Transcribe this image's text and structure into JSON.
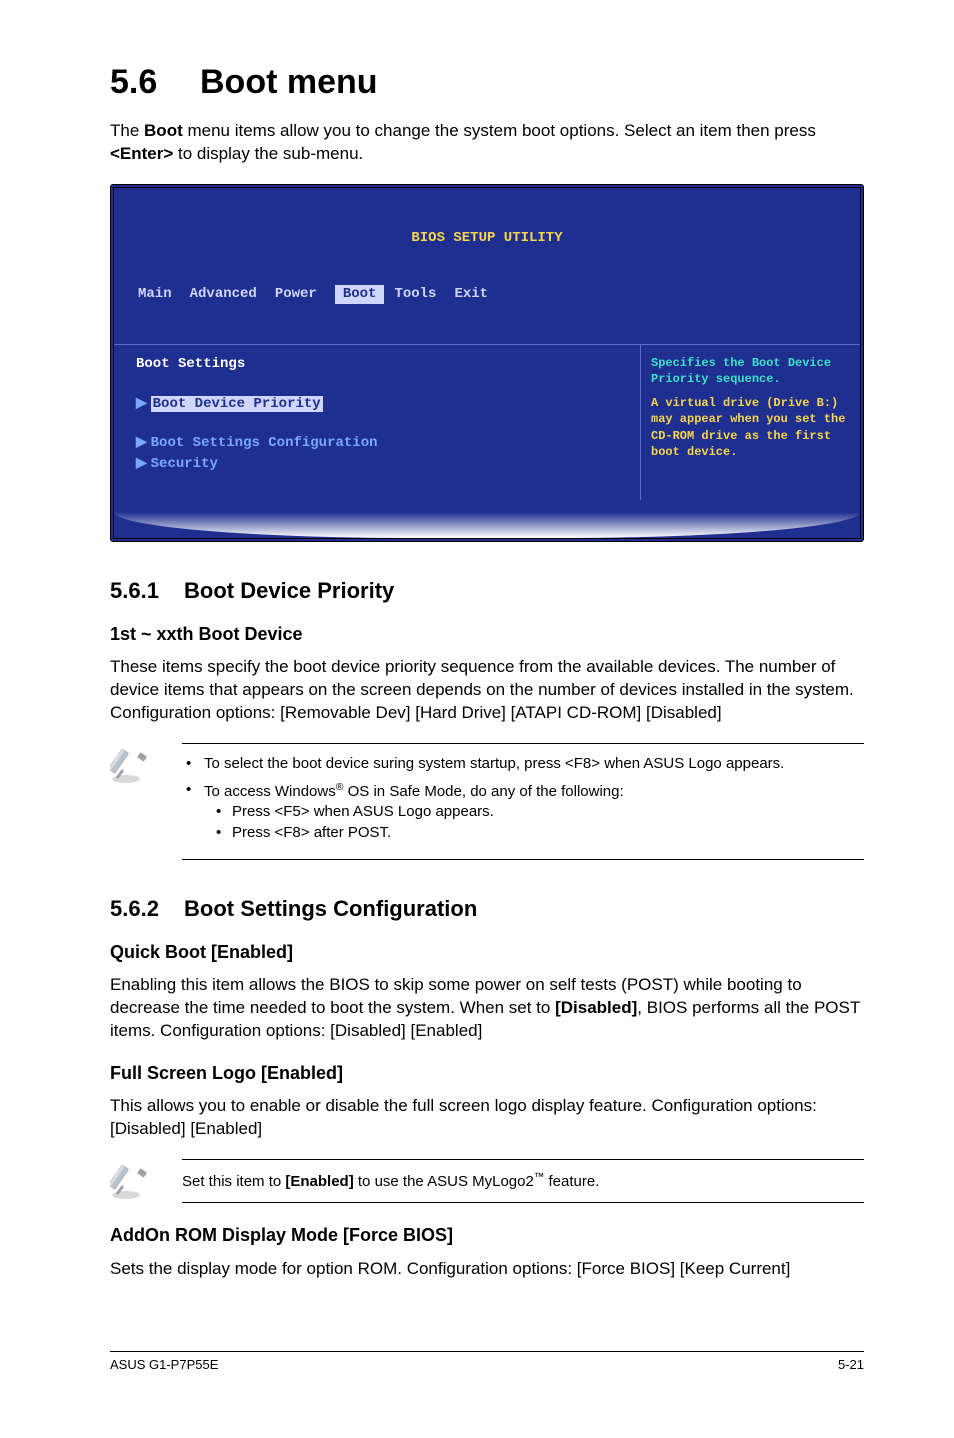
{
  "h1": {
    "num": "5.6",
    "title": "Boot menu"
  },
  "intro": {
    "pre": "The ",
    "boot": "Boot",
    "mid": " menu items allow you to change the system boot options. Select an item then press ",
    "enter": "<Enter>",
    "post": " to display the sub-menu."
  },
  "bios": {
    "title": "BIOS SETUP UTILITY",
    "tabs": {
      "main": "Main",
      "advanced": "Advanced",
      "power": "Power",
      "boot": "Boot",
      "tools": "Tools",
      "exit": "Exit"
    },
    "left": {
      "heading": "Boot Settings",
      "item1": "Boot Device Priority",
      "item2": "Boot Settings Configuration",
      "item3": "Security"
    },
    "right": {
      "l1": "Specifies the Boot Device Priority sequence.",
      "l2": "A virtual drive (Drive B:) may appear when you set the CD-ROM drive as the first boot device."
    }
  },
  "s561": {
    "num": "5.6.1",
    "title": "Boot Device Priority",
    "sub": "1st ~ xxth Boot Device",
    "body": "These items specify the boot device priority sequence from the available devices. The number of device items that appears on the screen depends on the number of devices installed in the system. Configuration options: [Removable Dev] [Hard Drive] [ATAPI CD-ROM] [Disabled]"
  },
  "note1": {
    "li1": "To select the boot device suring system startup, press <F8> when ASUS Logo appears.",
    "li2a": "To access Windows",
    "li2reg": "®",
    "li2b": " OS in Safe Mode, do any of the following:",
    "sub1": "Press <F5> when ASUS Logo appears.",
    "sub2": "Press <F8> after POST."
  },
  "s562": {
    "num": "5.6.2",
    "title": "Boot Settings Configuration",
    "qb_h": "Quick Boot [Enabled]",
    "qb_b1": "Enabling this item allows the BIOS to skip some power on self tests (POST) while booting to decrease the time needed to boot the system. When set to ",
    "qb_dis": "[Disabled]",
    "qb_b2": ", BIOS performs all the POST items. Configuration options: [Disabled] [Enabled]",
    "fsl_h": "Full Screen Logo [Enabled]",
    "fsl_b": "This allows you to enable or disable the full screen logo display feature. Configuration options: [Disabled] [Enabled]"
  },
  "note2": {
    "pre": "Set this item to ",
    "en": "[Enabled]",
    "mid": " to use the ASUS MyLogo2",
    "tm": "™",
    "post": " feature."
  },
  "addon": {
    "h": "AddOn ROM Display Mode [Force BIOS]",
    "b": "Sets the display mode for option ROM. Configuration options: [Force BIOS] [Keep Current]"
  },
  "footer": {
    "left": "ASUS G1-P7P55E",
    "right": "5-21"
  }
}
